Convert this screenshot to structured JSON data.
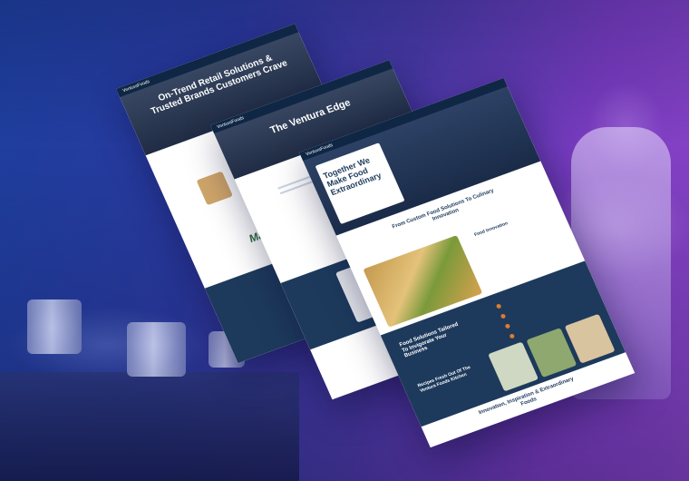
{
  "screens": {
    "back": {
      "brand": "VenturaFoods",
      "hero_title": "On-Trend Retail Solutions & Trusted Brands Customers Crave",
      "logo_text": "Marzetti"
    },
    "middle": {
      "brand": "VenturaFoods",
      "hero_title": "The Ventura Edge"
    },
    "front": {
      "brand": "VenturaFoods",
      "hero_title": "Together We Make Food Extraordinary",
      "section_title": "From Custom Food Solutions To Culinary Innovation",
      "food_innovation": "Food Innovation",
      "food_solutions": "Food Solutions Tailored To Invigorate Your Business",
      "recipes": "Recipes Fresh Out Of The Ventura Foods Kitchen",
      "footer_title": "Innovation, Inspiration & Extraordinary Foods"
    }
  },
  "colors": {
    "navy": "#1d3a5c",
    "accent": "#e07b2c",
    "bg_start": "#1e3f9e",
    "bg_end": "#8a45c8"
  }
}
